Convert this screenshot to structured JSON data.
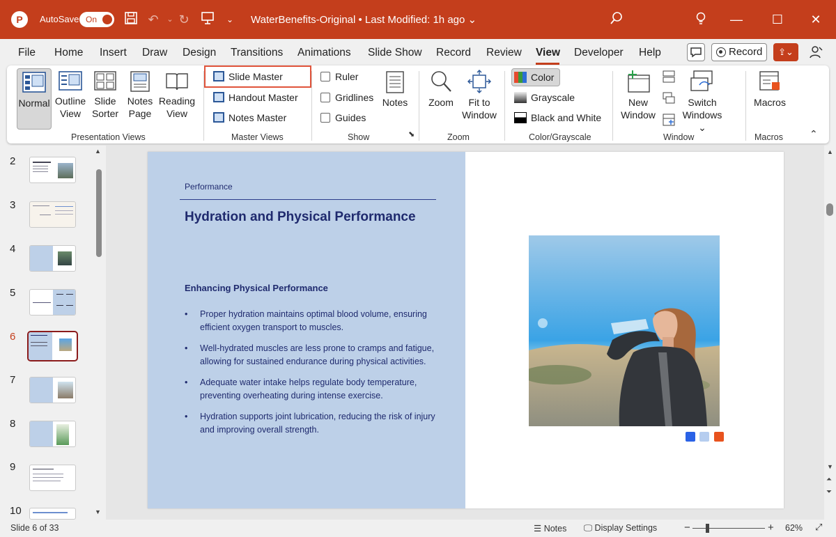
{
  "titlebar": {
    "logo_letter": "P",
    "autosave_label": "AutoSave",
    "autosave_state": "On",
    "document_title": "WaterBenefits-Original • Last Modified: 1h ago",
    "dropdown_glyph": "⌄"
  },
  "menu": {
    "tabs": [
      "File",
      "Home",
      "Insert",
      "Draw",
      "Design",
      "Transitions",
      "Animations",
      "Slide Show",
      "Record",
      "Review",
      "View",
      "Developer",
      "Help"
    ],
    "active": "View",
    "record_label": "Record"
  },
  "ribbon": {
    "presentation_views": {
      "label": "Presentation Views",
      "normal": "Normal",
      "outline_1": "Outline",
      "outline_2": "View",
      "sorter_1": "Slide",
      "sorter_2": "Sorter",
      "notes_1": "Notes",
      "notes_2": "Page",
      "reading_1": "Reading",
      "reading_2": "View"
    },
    "master_views": {
      "label": "Master Views",
      "slide_master": "Slide Master",
      "handout_master": "Handout Master",
      "notes_master": "Notes Master"
    },
    "show": {
      "label": "Show",
      "ruler": "Ruler",
      "gridlines": "Gridlines",
      "guides": "Guides",
      "notes": "Notes"
    },
    "zoom": {
      "label": "Zoom",
      "zoom": "Zoom",
      "fit_1": "Fit to",
      "fit_2": "Window"
    },
    "color": {
      "label": "Color/Grayscale",
      "color": "Color",
      "grayscale": "Grayscale",
      "bw": "Black and White"
    },
    "window": {
      "label": "Window",
      "new_1": "New",
      "new_2": "Window",
      "switch_1": "Switch",
      "switch_2": "Windows ⌄"
    },
    "macros": {
      "label": "Macros",
      "macros": "Macros"
    }
  },
  "thumbnails": {
    "numbers": [
      "2",
      "3",
      "4",
      "5",
      "6",
      "7",
      "8",
      "9",
      "10"
    ],
    "current": "6"
  },
  "slide": {
    "section": "Performance",
    "title": "Hydration and Physical Performance",
    "subtitle": "Enhancing Physical Performance",
    "bullets": [
      "Proper hydration maintains optimal blood volume, ensuring efficient oxygen transport to muscles.",
      "Well-hydrated muscles are less prone to cramps and fatigue, allowing for sustained endurance during physical activities.",
      "Adequate water intake helps regulate body temperature, preventing overheating during intense exercise.",
      "Hydration supports joint lubrication, reducing the risk of injury and improving overall strength."
    ],
    "dot_colors": [
      "#2a62e6",
      "#b6cdef",
      "#e8531e"
    ]
  },
  "status": {
    "slide_info": "Slide 6 of 33",
    "notes": "Notes",
    "display_settings": "Display Settings",
    "zoom_minus": "−",
    "zoom_plus": "+",
    "zoom_percent": "62%"
  },
  "colors": {
    "accent": "#c43e1c",
    "slide_panel": "#bdd0e8",
    "slide_text": "#1f2a6e",
    "highlight_box": "#e0533a"
  }
}
